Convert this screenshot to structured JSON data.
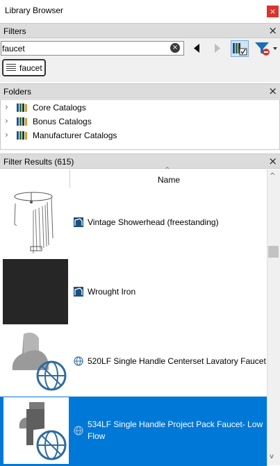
{
  "window": {
    "title": "Library Browser",
    "close_glyph": "×"
  },
  "filters": {
    "header": "Filters",
    "close_glyph": "×",
    "search": {
      "value": "faucet",
      "placeholder": ""
    },
    "clear_glyph": "×",
    "active_tags": [
      "faucet"
    ],
    "icons": [
      "prev-arrow-icon",
      "next-arrow-icon",
      "catalog-filter-icon",
      "funnel-icon"
    ]
  },
  "folders": {
    "header": "Folders",
    "close_glyph": "×",
    "items": [
      {
        "label": "Core Catalogs"
      },
      {
        "label": "Bonus Catalogs"
      },
      {
        "label": "Manufacturer Catalogs"
      }
    ]
  },
  "results": {
    "header": "Filter Results (615)",
    "close_glyph": "×",
    "column_name": "Name",
    "rows": [
      {
        "name": "Vintage Showerhead (freestanding)",
        "type_icon": "catalog-item-icon",
        "selected": false
      },
      {
        "name": "Wrought Iron",
        "type_icon": "catalog-item-icon",
        "selected": false
      },
      {
        "name": "520LF Single Handle Centerset Lavatory Faucet",
        "type_icon": "web-globe-icon",
        "selected": false
      },
      {
        "name_line1": "534LF Single Handle Project Pack Faucet- Low",
        "name_line2": "Flow",
        "type_icon": "web-globe-icon",
        "selected": true
      }
    ]
  },
  "colors": {
    "selection": "#0078d7",
    "close_red": "#d9342b",
    "header_gray": "#dcdcdc"
  }
}
